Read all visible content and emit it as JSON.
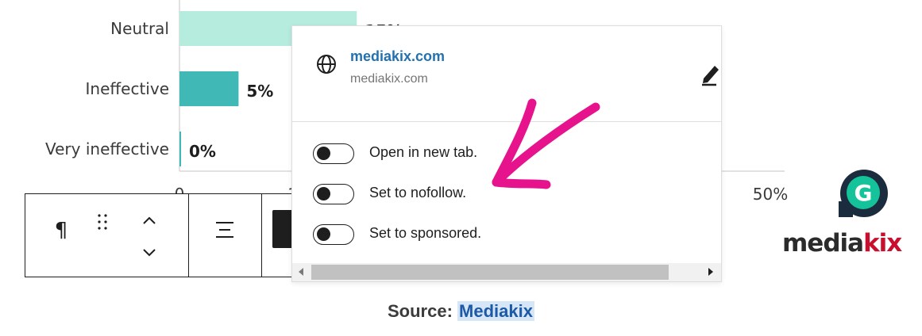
{
  "chart_data": {
    "type": "bar",
    "orientation": "horizontal",
    "categories": [
      "Neutral",
      "Ineffective",
      "Very ineffective"
    ],
    "values": [
      15,
      5,
      0
    ],
    "value_labels": [
      "15%",
      "5%",
      "0%"
    ],
    "colors": [
      "#b5ecdd",
      "#3fb8b6",
      "#3fb8b6"
    ],
    "xlim": [
      0,
      50
    ],
    "x_ticks": [
      "0",
      "10",
      "50%"
    ],
    "xlabel": "",
    "ylabel": "",
    "grid": false
  },
  "toolbar": {
    "paragraph_icon": "¶",
    "drag_icon": "drag-handle-icon",
    "move_up_icon": "chevron-up-icon",
    "move_down_icon": "chevron-down-icon",
    "align_icon": "align-center-icon"
  },
  "link_popover": {
    "title": "mediakix.com",
    "url": "mediakix.com",
    "icon": "globe-icon",
    "edit_icon": "pencil-icon",
    "options": [
      {
        "label": "Open in new tab.",
        "checked": false
      },
      {
        "label": "Set to nofollow.",
        "checked": false
      },
      {
        "label": "Set to sponsored.",
        "checked": false
      }
    ]
  },
  "grammarly": {
    "letter": "G"
  },
  "logo": {
    "main": "media",
    "accent": "kix"
  },
  "caption": {
    "prefix": "Source:",
    "link": "Mediakix"
  },
  "colors": {
    "accent_link": "#2271b1",
    "annotation_arrow": "#e6138c"
  }
}
